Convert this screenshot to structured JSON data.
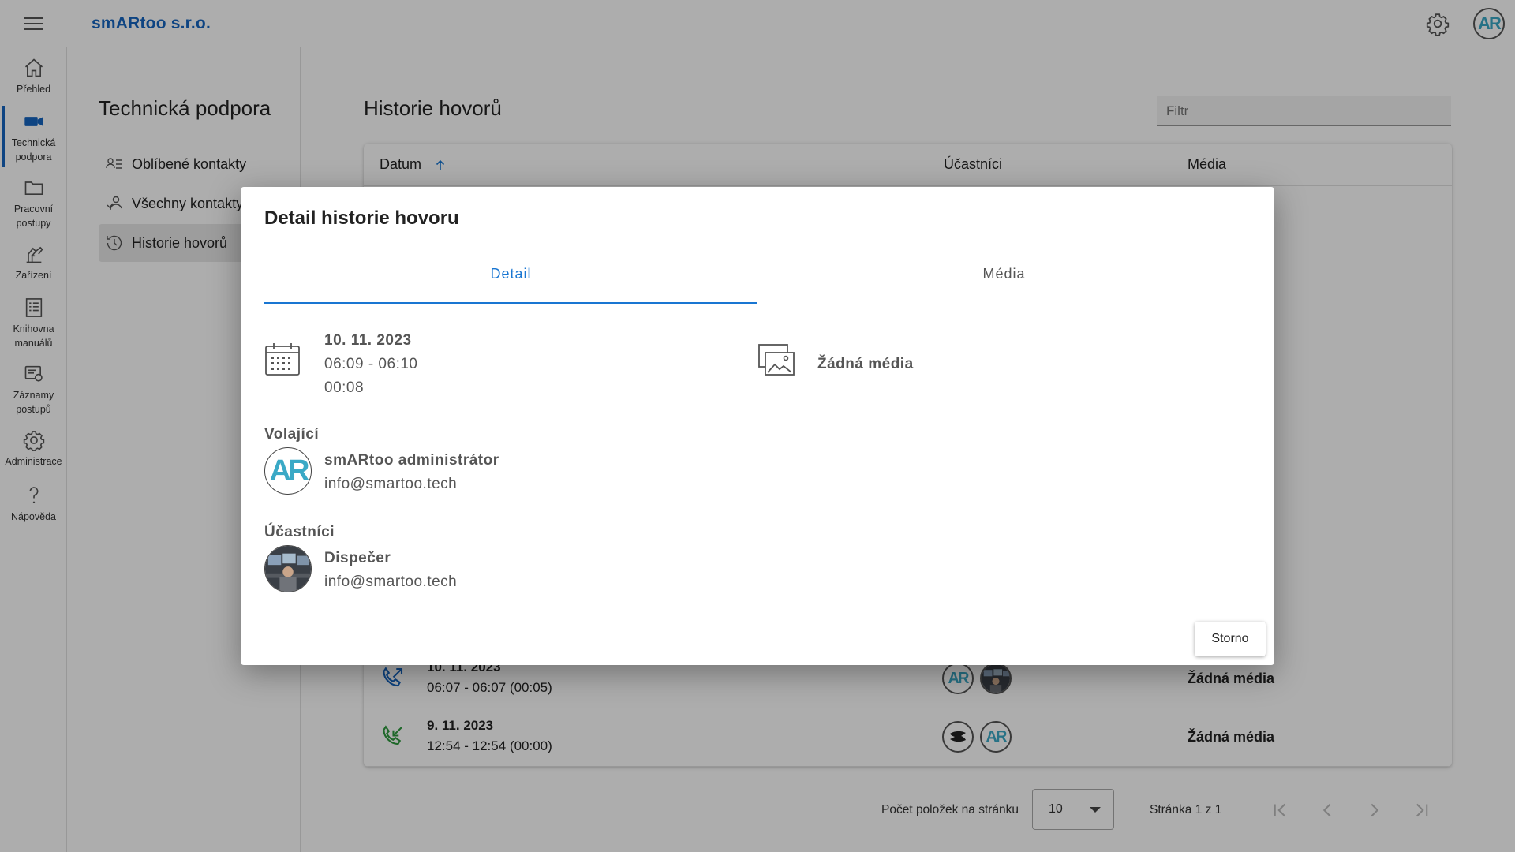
{
  "app": {
    "company": "smARtoo s.r.o.",
    "avatar_text": "AR"
  },
  "rail": [
    {
      "label": "Přehled",
      "icon": "home-icon"
    },
    {
      "label": "Technická podpora",
      "icon": "video-camera-icon"
    },
    {
      "label": "Pracovní postupy",
      "icon": "folder-icon"
    },
    {
      "label": "Zařízení",
      "icon": "equipment-icon"
    },
    {
      "label": "Knihovna manuálů",
      "icon": "manual-list-icon"
    },
    {
      "label": "Záznamy postupů",
      "icon": "records-icon"
    },
    {
      "label": "Administrace",
      "icon": "gear-icon"
    },
    {
      "label": "Nápověda",
      "icon": "question-icon"
    }
  ],
  "subnav": {
    "title": "Technická podpora",
    "items": [
      {
        "label": "Oblíbené kontakty",
        "icon": "favorite-contacts-icon"
      },
      {
        "label": "Všechny kontakty",
        "icon": "contacts-icon"
      },
      {
        "label": "Historie hovorů",
        "icon": "history-icon"
      }
    ]
  },
  "main": {
    "title": "Historie hovorů",
    "filter_placeholder": "Filtr",
    "columns": [
      "Datum",
      "Účastníci",
      "Média"
    ],
    "rows": [
      {
        "date": "10. 11. 2023",
        "time": "06:07 - 06:07 (00:05)",
        "media": "Žádná média",
        "call_type": "outgoing",
        "avatars": [
          "AR",
          "photo"
        ]
      },
      {
        "date": "9. 11. 2023",
        "time": "12:54 - 12:54 (00:00)",
        "media": "Žádná média",
        "call_type": "incoming",
        "avatars": [
          "logo",
          "AR"
        ]
      }
    ],
    "pager": {
      "label": "Počet položek na stránku",
      "page_size": "10",
      "info": "Stránka 1 z 1"
    }
  },
  "dialog": {
    "title": "Detail historie hovoru",
    "tabs": [
      "Detail",
      "Média"
    ],
    "date": "10. 11. 2023",
    "range": "06:09 - 06:10",
    "duration": "00:08",
    "media": "Žádná média",
    "caller_label": "Volající",
    "caller": {
      "name": "smARtoo administrátor",
      "email": "info@smartoo.tech",
      "avatar": "AR"
    },
    "participants_label": "Účastníci",
    "participant": {
      "name": "Dispečer",
      "email": "info@smartoo.tech"
    },
    "close_label": "Storno"
  },
  "colors": {
    "brand": "#1565c0",
    "accent_tab": "#1976d2",
    "avatar_text": "#3aa9c6",
    "call_icon": "#2e9a3e"
  }
}
